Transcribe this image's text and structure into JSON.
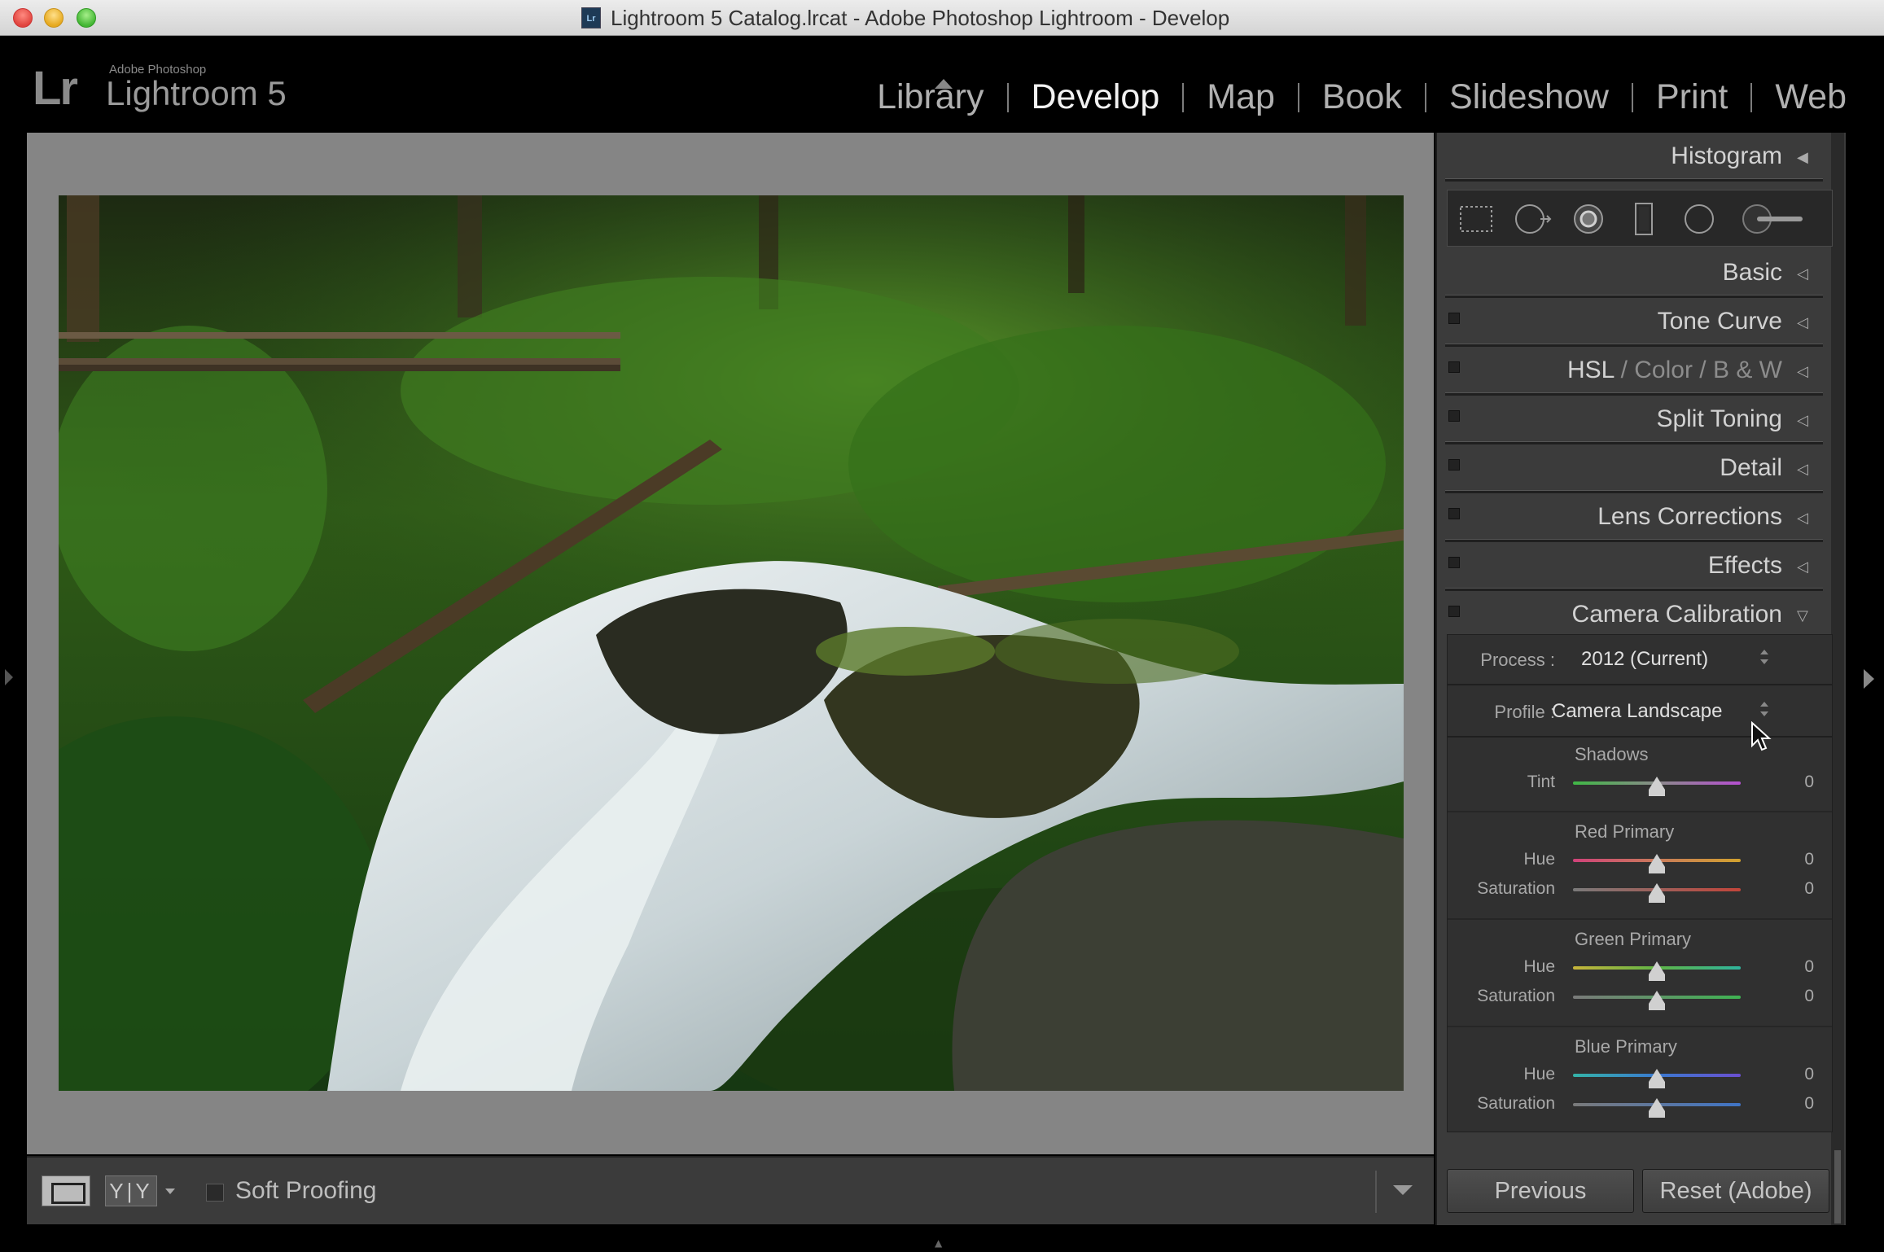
{
  "window": {
    "title": "Lightroom 5 Catalog.lrcat - Adobe Photoshop Lightroom - Develop",
    "doc_icon": "Lr"
  },
  "brand": {
    "logo": "Lr",
    "small": "Adobe Photoshop",
    "name": "Lightroom 5"
  },
  "modules": [
    {
      "label": "Library",
      "active": false
    },
    {
      "label": "Develop",
      "active": true
    },
    {
      "label": "Map",
      "active": false
    },
    {
      "label": "Book",
      "active": false
    },
    {
      "label": "Slideshow",
      "active": false
    },
    {
      "label": "Print",
      "active": false
    },
    {
      "label": "Web",
      "active": false
    }
  ],
  "panels": {
    "histogram": "Histogram",
    "basic": "Basic",
    "tone_curve": "Tone Curve",
    "hsl": {
      "a": "HSL",
      "sep1": "/",
      "b": "Color",
      "sep2": "/",
      "c": "B & W"
    },
    "split_toning": "Split Toning",
    "detail": "Detail",
    "lens_corrections": "Lens Corrections",
    "effects": "Effects",
    "camera_calibration": "Camera Calibration"
  },
  "tools": [
    "crop-overlay-icon",
    "spot-removal-icon",
    "red-eye-icon",
    "graduated-filter-icon",
    "radial-filter-icon",
    "adjustment-brush-icon"
  ],
  "calibration": {
    "process_label": "Process :",
    "process_value": "2012 (Current)",
    "profile_label": "Profile :",
    "profile_value": "Camera Landscape",
    "shadows": {
      "title": "Shadows",
      "tint_label": "Tint",
      "tint_value": "0"
    },
    "red": {
      "title": "Red Primary",
      "hue_label": "Hue",
      "hue_value": "0",
      "sat_label": "Saturation",
      "sat_value": "0"
    },
    "green": {
      "title": "Green Primary",
      "hue_label": "Hue",
      "hue_value": "0",
      "sat_label": "Saturation",
      "sat_value": "0"
    },
    "blue": {
      "title": "Blue Primary",
      "hue_label": "Hue",
      "hue_value": "0",
      "sat_label": "Saturation",
      "sat_value": "0"
    }
  },
  "toolbar": {
    "yy": "Y|Y",
    "soft_proofing": "Soft Proofing"
  },
  "buttons": {
    "previous": "Previous",
    "reset": "Reset (Adobe)"
  }
}
